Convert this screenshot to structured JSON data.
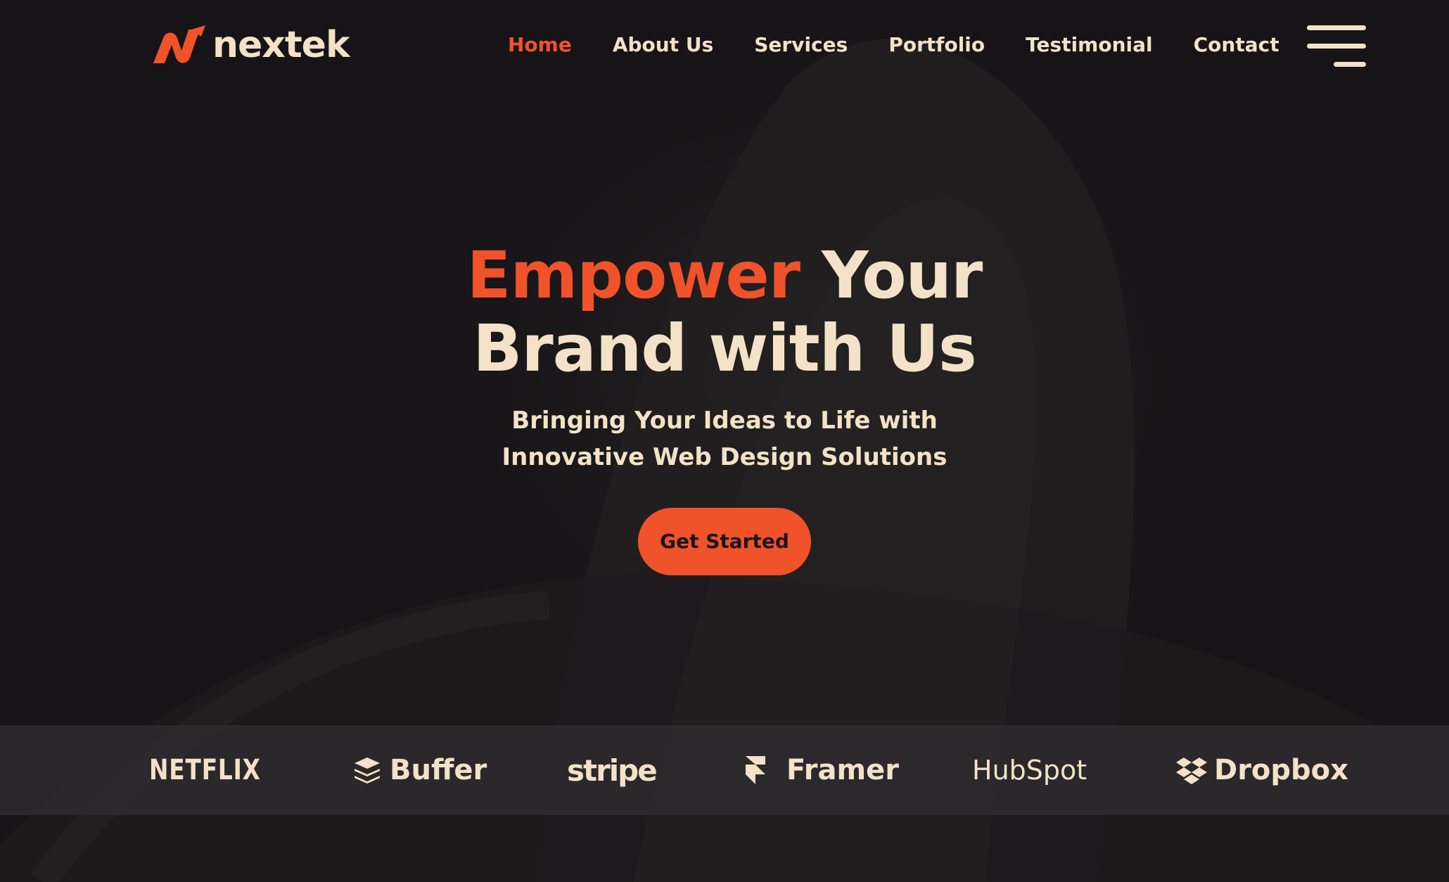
{
  "brand": {
    "name": "nextek",
    "accent_color": "#f0522a",
    "text_color": "#f3e2c7",
    "background": "#161416"
  },
  "nav": {
    "items": [
      {
        "label": "Home",
        "active": true
      },
      {
        "label": "About Us",
        "active": false
      },
      {
        "label": "Services",
        "active": false
      },
      {
        "label": "Portfolio",
        "active": false
      },
      {
        "label": "Testimonial",
        "active": false
      },
      {
        "label": "Contact",
        "active": false
      }
    ],
    "menu_icon": "hamburger-menu-icon"
  },
  "hero": {
    "title_accent": "Empower",
    "title_rest_line1": " Your",
    "title_line2": "Brand with Us",
    "subtitle_line1": "Bringing Your Ideas to Life with",
    "subtitle_line2": "Innovative Web Design Solutions",
    "cta_label": "Get Started"
  },
  "partners": [
    {
      "name": "NETFLIX",
      "icon": ""
    },
    {
      "name": "Buffer",
      "icon": "buffer-stack-icon"
    },
    {
      "name": "stripe",
      "icon": ""
    },
    {
      "name": "Framer",
      "icon": "framer-icon"
    },
    {
      "name": "HubSpot",
      "icon": ""
    },
    {
      "name": "Dropbox",
      "icon": "dropbox-icon"
    }
  ]
}
